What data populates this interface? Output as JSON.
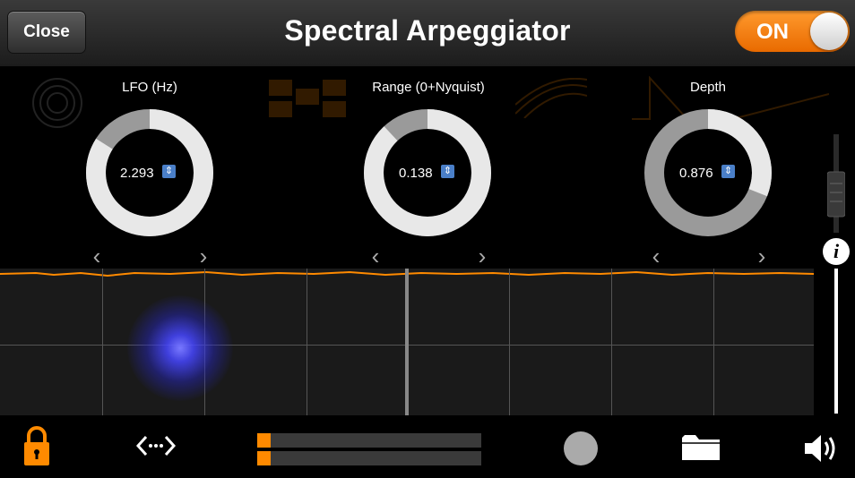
{
  "header": {
    "close_label": "Close",
    "title": "Spectral Arpeggiator",
    "toggle_label": "ON",
    "toggle_on": true
  },
  "knobs": [
    {
      "title": "LFO (Hz)",
      "value": "2.293",
      "fill_fraction": 0.84
    },
    {
      "title": "Range (0+Nyquist)",
      "value": "0.138",
      "fill_fraction": 0.88
    },
    {
      "title": "Depth",
      "value": "0.876",
      "fill_fraction": 0.31
    }
  ],
  "icons": {
    "prev": "chevron-left-icon",
    "next": "chevron-right-icon",
    "info": "info-icon",
    "lock": "lock-icon",
    "expand": "horizontal-expand-icon",
    "record": "record-icon",
    "folder": "folder-icon",
    "volume": "speaker-icon"
  },
  "info_label": "i",
  "stepper_glyph": "⇕",
  "prev_glyph": "‹",
  "next_glyph": "›",
  "levels": [
    0.06,
    0.06
  ],
  "colors": {
    "accent": "#ff8a00",
    "knob_track": "#9a9a9a",
    "knob_fill": "#e8e8e8",
    "glow": "#5050ff"
  }
}
